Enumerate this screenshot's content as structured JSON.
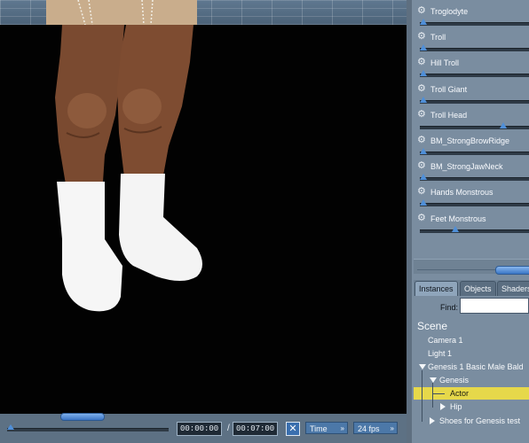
{
  "morphs": [
    {
      "label": "Troglodyte",
      "value": 0.0
    },
    {
      "label": "Troll",
      "value": 0.0
    },
    {
      "label": "Hill Troll",
      "value": 0.0
    },
    {
      "label": "Troll Giant",
      "value": 0.0
    },
    {
      "label": "Troll Head",
      "value": 0.75
    },
    {
      "label": "BM_StrongBrowRidge",
      "value": 0.0
    },
    {
      "label": "BM_StrongJawNeck",
      "value": 0.0
    },
    {
      "label": "Hands Monstrous",
      "value": 0.0
    },
    {
      "label": "Feet Monstrous",
      "value": 0.3
    }
  ],
  "tabs": [
    {
      "label": "Instances",
      "active": true
    },
    {
      "label": "Objects",
      "active": false
    },
    {
      "label": "Shaders",
      "active": false
    }
  ],
  "find": {
    "label": "Find:",
    "value": ""
  },
  "scene": {
    "title": "Scene",
    "items": [
      {
        "label": "Camera 1"
      },
      {
        "label": "Light 1"
      },
      {
        "label": "Genesis 1 Basic Male Bald"
      },
      {
        "label": "Genesis"
      },
      {
        "label": "Actor"
      },
      {
        "label": "Hip"
      },
      {
        "label": "Shoes for Genesis test"
      }
    ]
  },
  "timeline": {
    "current_time": "00:00:00",
    "end_time": "00:07:00",
    "separator": "/",
    "mode": "Time",
    "fps": "24 fps"
  },
  "colors": {
    "accent": "#4f8fd8",
    "selected_row": "#e6d84a",
    "panel": "#7a8da0"
  }
}
